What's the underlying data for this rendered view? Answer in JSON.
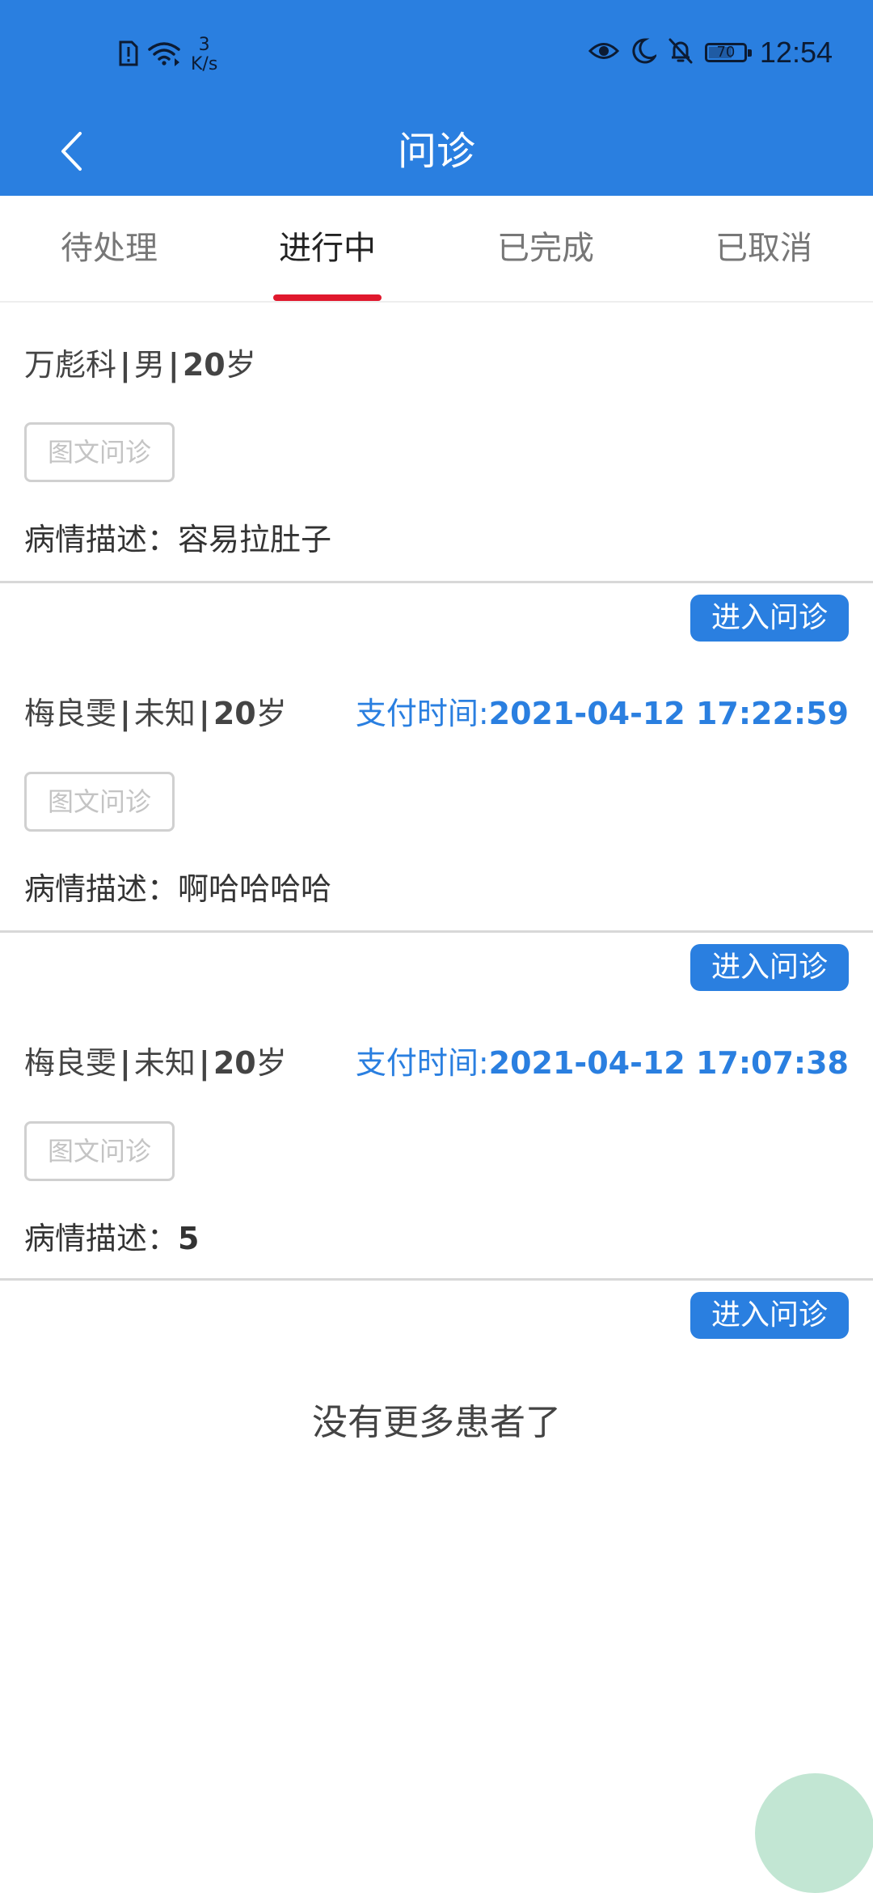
{
  "status_bar": {
    "net_speed_value": "3",
    "net_speed_unit": "K/s",
    "battery_level": "70",
    "time": "12:54"
  },
  "header": {
    "title": "问诊"
  },
  "tabs": [
    {
      "label": "待处理",
      "active": false
    },
    {
      "label": "进行中",
      "active": true
    },
    {
      "label": "已完成",
      "active": false
    },
    {
      "label": "已取消",
      "active": false
    }
  ],
  "consultations": [
    {
      "name": "万彪科",
      "gender": "男",
      "age": "20",
      "age_unit": "岁",
      "type": "图文问诊",
      "desc_label": "病情描述：",
      "desc": "容易拉肚子",
      "pay_label": "",
      "pay_time": ""
    },
    {
      "enter_label": "进入问诊",
      "name": "梅良雯",
      "gender": "未知",
      "age": "20",
      "age_unit": "岁",
      "pay_label": "支付时间:",
      "pay_time": "2021-04-12 17:22:59",
      "type": "图文问诊",
      "desc_label": "病情描述：",
      "desc": "啊哈哈哈哈"
    },
    {
      "enter_label": "进入问诊",
      "name": "梅良雯",
      "gender": "未知",
      "age": "20",
      "age_unit": "岁",
      "pay_label": "支付时间:",
      "pay_time": "2021-04-12 17:07:38",
      "type": "图文问诊",
      "desc_label": "病情描述：",
      "desc": "5"
    }
  ],
  "last_enter_label": "进入问诊",
  "footer": {
    "no_more_text": "没有更多患者了"
  },
  "colors": {
    "primary": "#2a7fe0",
    "tab_indicator": "#e0182d",
    "fab": "#c2e6d3"
  }
}
